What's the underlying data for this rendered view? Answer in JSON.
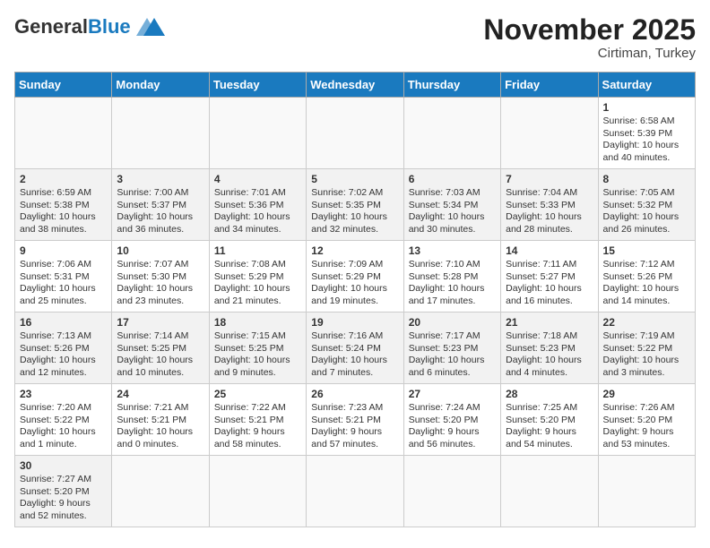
{
  "header": {
    "logo_general": "General",
    "logo_blue": "Blue",
    "month_title": "November 2025",
    "location": "Cirtiman, Turkey"
  },
  "weekdays": [
    "Sunday",
    "Monday",
    "Tuesday",
    "Wednesday",
    "Thursday",
    "Friday",
    "Saturday"
  ],
  "weeks": [
    [
      {
        "day": "",
        "info": ""
      },
      {
        "day": "",
        "info": ""
      },
      {
        "day": "",
        "info": ""
      },
      {
        "day": "",
        "info": ""
      },
      {
        "day": "",
        "info": ""
      },
      {
        "day": "",
        "info": ""
      },
      {
        "day": "1",
        "info": "Sunrise: 6:58 AM\nSunset: 5:39 PM\nDaylight: 10 hours and 40 minutes."
      }
    ],
    [
      {
        "day": "2",
        "info": "Sunrise: 6:59 AM\nSunset: 5:38 PM\nDaylight: 10 hours and 38 minutes."
      },
      {
        "day": "3",
        "info": "Sunrise: 7:00 AM\nSunset: 5:37 PM\nDaylight: 10 hours and 36 minutes."
      },
      {
        "day": "4",
        "info": "Sunrise: 7:01 AM\nSunset: 5:36 PM\nDaylight: 10 hours and 34 minutes."
      },
      {
        "day": "5",
        "info": "Sunrise: 7:02 AM\nSunset: 5:35 PM\nDaylight: 10 hours and 32 minutes."
      },
      {
        "day": "6",
        "info": "Sunrise: 7:03 AM\nSunset: 5:34 PM\nDaylight: 10 hours and 30 minutes."
      },
      {
        "day": "7",
        "info": "Sunrise: 7:04 AM\nSunset: 5:33 PM\nDaylight: 10 hours and 28 minutes."
      },
      {
        "day": "8",
        "info": "Sunrise: 7:05 AM\nSunset: 5:32 PM\nDaylight: 10 hours and 26 minutes."
      }
    ],
    [
      {
        "day": "9",
        "info": "Sunrise: 7:06 AM\nSunset: 5:31 PM\nDaylight: 10 hours and 25 minutes."
      },
      {
        "day": "10",
        "info": "Sunrise: 7:07 AM\nSunset: 5:30 PM\nDaylight: 10 hours and 23 minutes."
      },
      {
        "day": "11",
        "info": "Sunrise: 7:08 AM\nSunset: 5:29 PM\nDaylight: 10 hours and 21 minutes."
      },
      {
        "day": "12",
        "info": "Sunrise: 7:09 AM\nSunset: 5:29 PM\nDaylight: 10 hours and 19 minutes."
      },
      {
        "day": "13",
        "info": "Sunrise: 7:10 AM\nSunset: 5:28 PM\nDaylight: 10 hours and 17 minutes."
      },
      {
        "day": "14",
        "info": "Sunrise: 7:11 AM\nSunset: 5:27 PM\nDaylight: 10 hours and 16 minutes."
      },
      {
        "day": "15",
        "info": "Sunrise: 7:12 AM\nSunset: 5:26 PM\nDaylight: 10 hours and 14 minutes."
      }
    ],
    [
      {
        "day": "16",
        "info": "Sunrise: 7:13 AM\nSunset: 5:26 PM\nDaylight: 10 hours and 12 minutes."
      },
      {
        "day": "17",
        "info": "Sunrise: 7:14 AM\nSunset: 5:25 PM\nDaylight: 10 hours and 10 minutes."
      },
      {
        "day": "18",
        "info": "Sunrise: 7:15 AM\nSunset: 5:25 PM\nDaylight: 10 hours and 9 minutes."
      },
      {
        "day": "19",
        "info": "Sunrise: 7:16 AM\nSunset: 5:24 PM\nDaylight: 10 hours and 7 minutes."
      },
      {
        "day": "20",
        "info": "Sunrise: 7:17 AM\nSunset: 5:23 PM\nDaylight: 10 hours and 6 minutes."
      },
      {
        "day": "21",
        "info": "Sunrise: 7:18 AM\nSunset: 5:23 PM\nDaylight: 10 hours and 4 minutes."
      },
      {
        "day": "22",
        "info": "Sunrise: 7:19 AM\nSunset: 5:22 PM\nDaylight: 10 hours and 3 minutes."
      }
    ],
    [
      {
        "day": "23",
        "info": "Sunrise: 7:20 AM\nSunset: 5:22 PM\nDaylight: 10 hours and 1 minute."
      },
      {
        "day": "24",
        "info": "Sunrise: 7:21 AM\nSunset: 5:21 PM\nDaylight: 10 hours and 0 minutes."
      },
      {
        "day": "25",
        "info": "Sunrise: 7:22 AM\nSunset: 5:21 PM\nDaylight: 9 hours and 58 minutes."
      },
      {
        "day": "26",
        "info": "Sunrise: 7:23 AM\nSunset: 5:21 PM\nDaylight: 9 hours and 57 minutes."
      },
      {
        "day": "27",
        "info": "Sunrise: 7:24 AM\nSunset: 5:20 PM\nDaylight: 9 hours and 56 minutes."
      },
      {
        "day": "28",
        "info": "Sunrise: 7:25 AM\nSunset: 5:20 PM\nDaylight: 9 hours and 54 minutes."
      },
      {
        "day": "29",
        "info": "Sunrise: 7:26 AM\nSunset: 5:20 PM\nDaylight: 9 hours and 53 minutes."
      }
    ],
    [
      {
        "day": "30",
        "info": "Sunrise: 7:27 AM\nSunset: 5:20 PM\nDaylight: 9 hours and 52 minutes."
      },
      {
        "day": "",
        "info": ""
      },
      {
        "day": "",
        "info": ""
      },
      {
        "day": "",
        "info": ""
      },
      {
        "day": "",
        "info": ""
      },
      {
        "day": "",
        "info": ""
      },
      {
        "day": "",
        "info": ""
      }
    ]
  ]
}
